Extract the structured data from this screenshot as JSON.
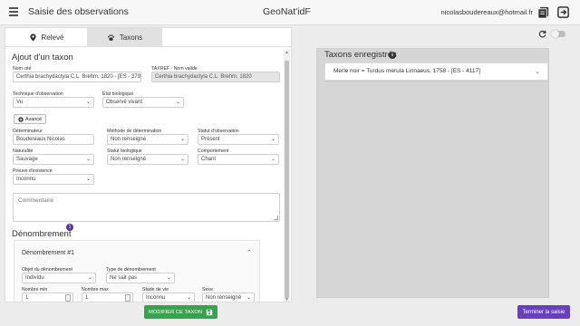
{
  "header": {
    "app_title": "Saisie des observations",
    "center_title": "GeoNat'idF",
    "user_email": "nicolasboudereaux@hotmail.fr"
  },
  "tabs": [
    {
      "label": "Relevé",
      "icon": "map-marker-icon",
      "active": false
    },
    {
      "label": "Taxons",
      "icon": "paw-icon",
      "active": true
    }
  ],
  "form": {
    "section_title": "Ajout d'un taxon",
    "nom_cite": {
      "label": "Nom cité",
      "value": "Certhia brachydactyla C.L. Brehm, 1820 - [ES - 379"
    },
    "nom_valide": {
      "label": "TAXREF - Nom valide",
      "value": "Certhia brachydactyla C.L. Brehm, 1820"
    },
    "technique": {
      "label": "Technique d'observation",
      "value": "Vu"
    },
    "etat_bio": {
      "label": "Etat biologique",
      "value": "Observé vivant"
    },
    "avance_label": "Avancé",
    "determinateur": {
      "label": "Déterminateur",
      "value": "Boudereaux Nicolas"
    },
    "methode_det": {
      "label": "Méthode de détermination",
      "value": "Non renseigné"
    },
    "statut_obs": {
      "label": "Statut d'observation",
      "value": "Présent"
    },
    "naturalite": {
      "label": "Naturalité",
      "value": "Sauvage"
    },
    "statut_bio": {
      "label": "Statut biologique",
      "value": "Non renseigné"
    },
    "comportement": {
      "label": "Comportement",
      "value": "Chant"
    },
    "preuve": {
      "label": "Preuve d'existence",
      "value": "Inconnu"
    },
    "commentaire_placeholder": "Commentaire"
  },
  "denombrement": {
    "title": "Dénombrement",
    "count_badge": "1",
    "card_title": "Dénombrement #1",
    "objet": {
      "label": "Objet du dénombrement",
      "value": "Individu"
    },
    "type": {
      "label": "Type de dénombrement",
      "value": "Ne sait pas"
    },
    "nombre_min": {
      "label": "Nombre min",
      "value": "1"
    },
    "nombre_max": {
      "label": "Nombre max",
      "value": "1"
    },
    "stade": {
      "label": "Stade de vie",
      "value": "Inconnu"
    },
    "sexe": {
      "label": "Sexe",
      "value": "Non renseigné"
    }
  },
  "right_panel": {
    "title": "Taxons enregistrés",
    "items": [
      "Merle noir = Turdus merula Linnaeus, 1758 - [ES - 4117]"
    ]
  },
  "buttons": {
    "modifier": "MODIFIER CE TAXON",
    "terminer": "Terminer la saisie"
  },
  "colors": {
    "green": "#36a44f",
    "purple": "#6a3fbf",
    "badge": "#5b31a8"
  }
}
